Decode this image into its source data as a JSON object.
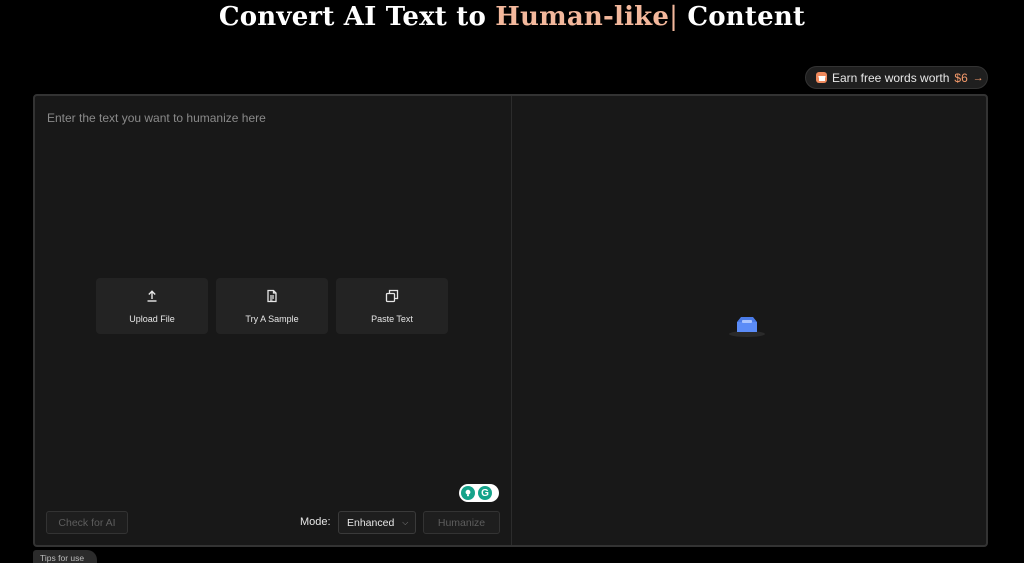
{
  "header": {
    "title_start": "Convert AI Text to ",
    "title_highlight": "Human-like",
    "title_caret": "|",
    "title_end": " Content",
    "highlight_color": "#f3b89c"
  },
  "promo": {
    "label": "Earn free words worth",
    "amount": "$6",
    "arrow": "→",
    "icon": "gift-icon"
  },
  "input": {
    "placeholder": "Enter the text you want to humanize here",
    "actions": [
      {
        "label": "Upload File",
        "icon": "upload-icon"
      },
      {
        "label": "Try A Sample",
        "icon": "document-icon"
      },
      {
        "label": "Paste Text",
        "icon": "copy-icon"
      }
    ]
  },
  "controls": {
    "check_label": "Check for AI",
    "mode_label": "Mode:",
    "mode_value": "Enhanced",
    "humanize_label": "Humanize"
  },
  "footer": {
    "tips_label": "Tips for use"
  },
  "colors": {
    "accent": "#f59a6b",
    "empty_icon": "#5b8cf7"
  }
}
